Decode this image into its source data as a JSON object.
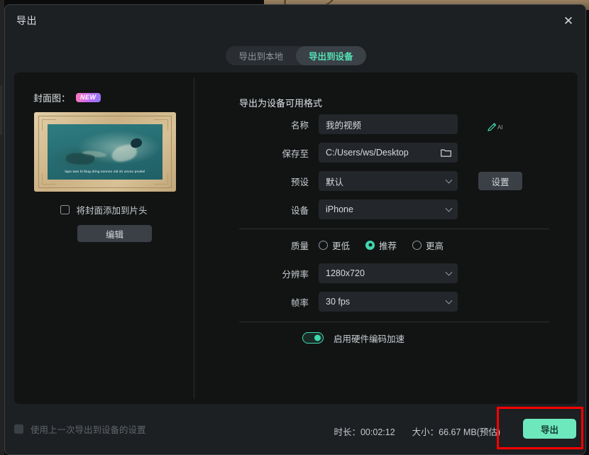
{
  "dialog": {
    "title": "导出",
    "close_label": "✕"
  },
  "tabs": [
    {
      "label": "导出到本地",
      "active": false
    },
    {
      "label": "导出到设备",
      "active": true
    }
  ],
  "left_panel": {
    "cover_label": "封面图：",
    "new_badge": "NEW",
    "thumbnail_caption": "lapo wan bi blug dring sonnon old sh onvoo pnokel",
    "add_cover_checkbox": {
      "label": "将封面添加到片头",
      "checked": false
    },
    "edit_button": "编辑"
  },
  "right_panel": {
    "section_title": "导出为设备可用格式",
    "fields": [
      {
        "label": "名称",
        "value": "我的视频",
        "type": "text"
      },
      {
        "label": "保存至",
        "value": "C:/Users/ws/Desktop",
        "type": "path"
      },
      {
        "label": "预设",
        "value": "默认",
        "type": "select"
      },
      {
        "label": "设备",
        "value": "iPhone",
        "type": "select"
      }
    ],
    "ai_icon_label": "AI",
    "settings_button": "设置",
    "quality": {
      "label": "质量",
      "options": [
        {
          "label": "更低",
          "selected": false
        },
        {
          "label": "推荐",
          "selected": true
        },
        {
          "label": "更高",
          "selected": false
        }
      ]
    },
    "resolution": {
      "label": "分辨率",
      "value": "1280x720"
    },
    "framerate": {
      "label": "帧率",
      "value": "30 fps"
    },
    "hardware_accel": {
      "label": "启用硬件编码加速",
      "enabled": true
    }
  },
  "footer": {
    "reuse_settings": {
      "label": "使用上一次导出到设备的设置",
      "checked": false,
      "disabled": true
    },
    "duration": "时长：00:02:12",
    "size": "大小：66.67 MB(预估)",
    "export_button": "导出"
  },
  "colors": {
    "accent_teal": "#3fd9ae",
    "export_button_bg": "#6de8bd",
    "annotation_red": "#fe0000",
    "badge_pink": "#ff7ab8",
    "dialog_bg": "#1d2023",
    "panel_bg": "#121414"
  }
}
